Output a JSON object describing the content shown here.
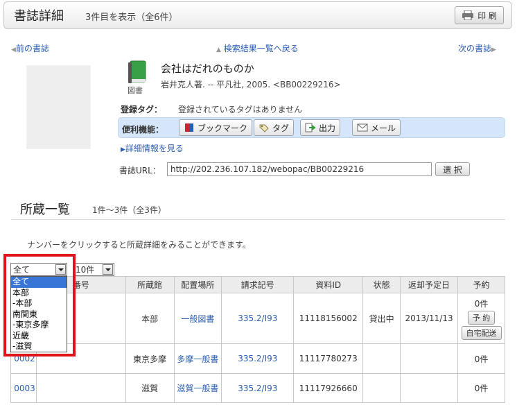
{
  "header": {
    "title": "書誌詳細",
    "count": "3件目を表示（全6件）",
    "print_label": "印 刷"
  },
  "nav": {
    "prev": "前の書誌",
    "back": "検索結果一覧へ戻る",
    "next": "次の書誌"
  },
  "record": {
    "material_type": "図書",
    "title": "会社はだれのものか",
    "sub": "岩井克人著. -- 平凡社, 2005. <BB00229216>",
    "tag_label": "登録タグ：",
    "tag_text": "登録されているタグはありません",
    "tools_label": "便利機能：",
    "tools": {
      "bookmark": "ブックマーク",
      "tag": "タグ",
      "output": "出力",
      "mail": "メール"
    },
    "detail_link": "詳細情報を見る",
    "url_label": "書誌URL：",
    "url_value": "http://202.236.107.182/webopac/BB00229216",
    "select_label": "選 択"
  },
  "holdings": {
    "title": "所蔵一覧",
    "count": "1件～3件（全3件）",
    "hint": "ナンバーをクリックすると所蔵詳細をみることができます。",
    "filter_selected": "全て",
    "filter_options": [
      "全て",
      "本部",
      "-本部",
      "南関東",
      "-東京多摩",
      "近畿",
      "-滋賀"
    ],
    "per_page": "10件",
    "columns": [
      "番号",
      "所蔵館",
      "配置場所",
      "請求記号",
      "資料ID",
      "状態",
      "返却予定日",
      "予約"
    ],
    "rows": [
      {
        "no": "",
        "library": "本部",
        "location": "一般図書",
        "call": "335.2/I93",
        "id": "11118156002",
        "status": "貸出中",
        "due": "2013/11/13",
        "reserve": "0件",
        "btn1": "予 約",
        "btn2": "自宅配送"
      },
      {
        "no": "0002",
        "library": "東京多摩",
        "location": "多摩一般書",
        "call": "335.2/I93",
        "id": "11117780273",
        "status": "",
        "due": "",
        "reserve": "0件"
      },
      {
        "no": "0003",
        "library": "滋賀",
        "location": "滋賀一般書",
        "call": "335.2/I93",
        "id": "11117926660",
        "status": "",
        "due": "",
        "reserve": "0件"
      }
    ]
  }
}
